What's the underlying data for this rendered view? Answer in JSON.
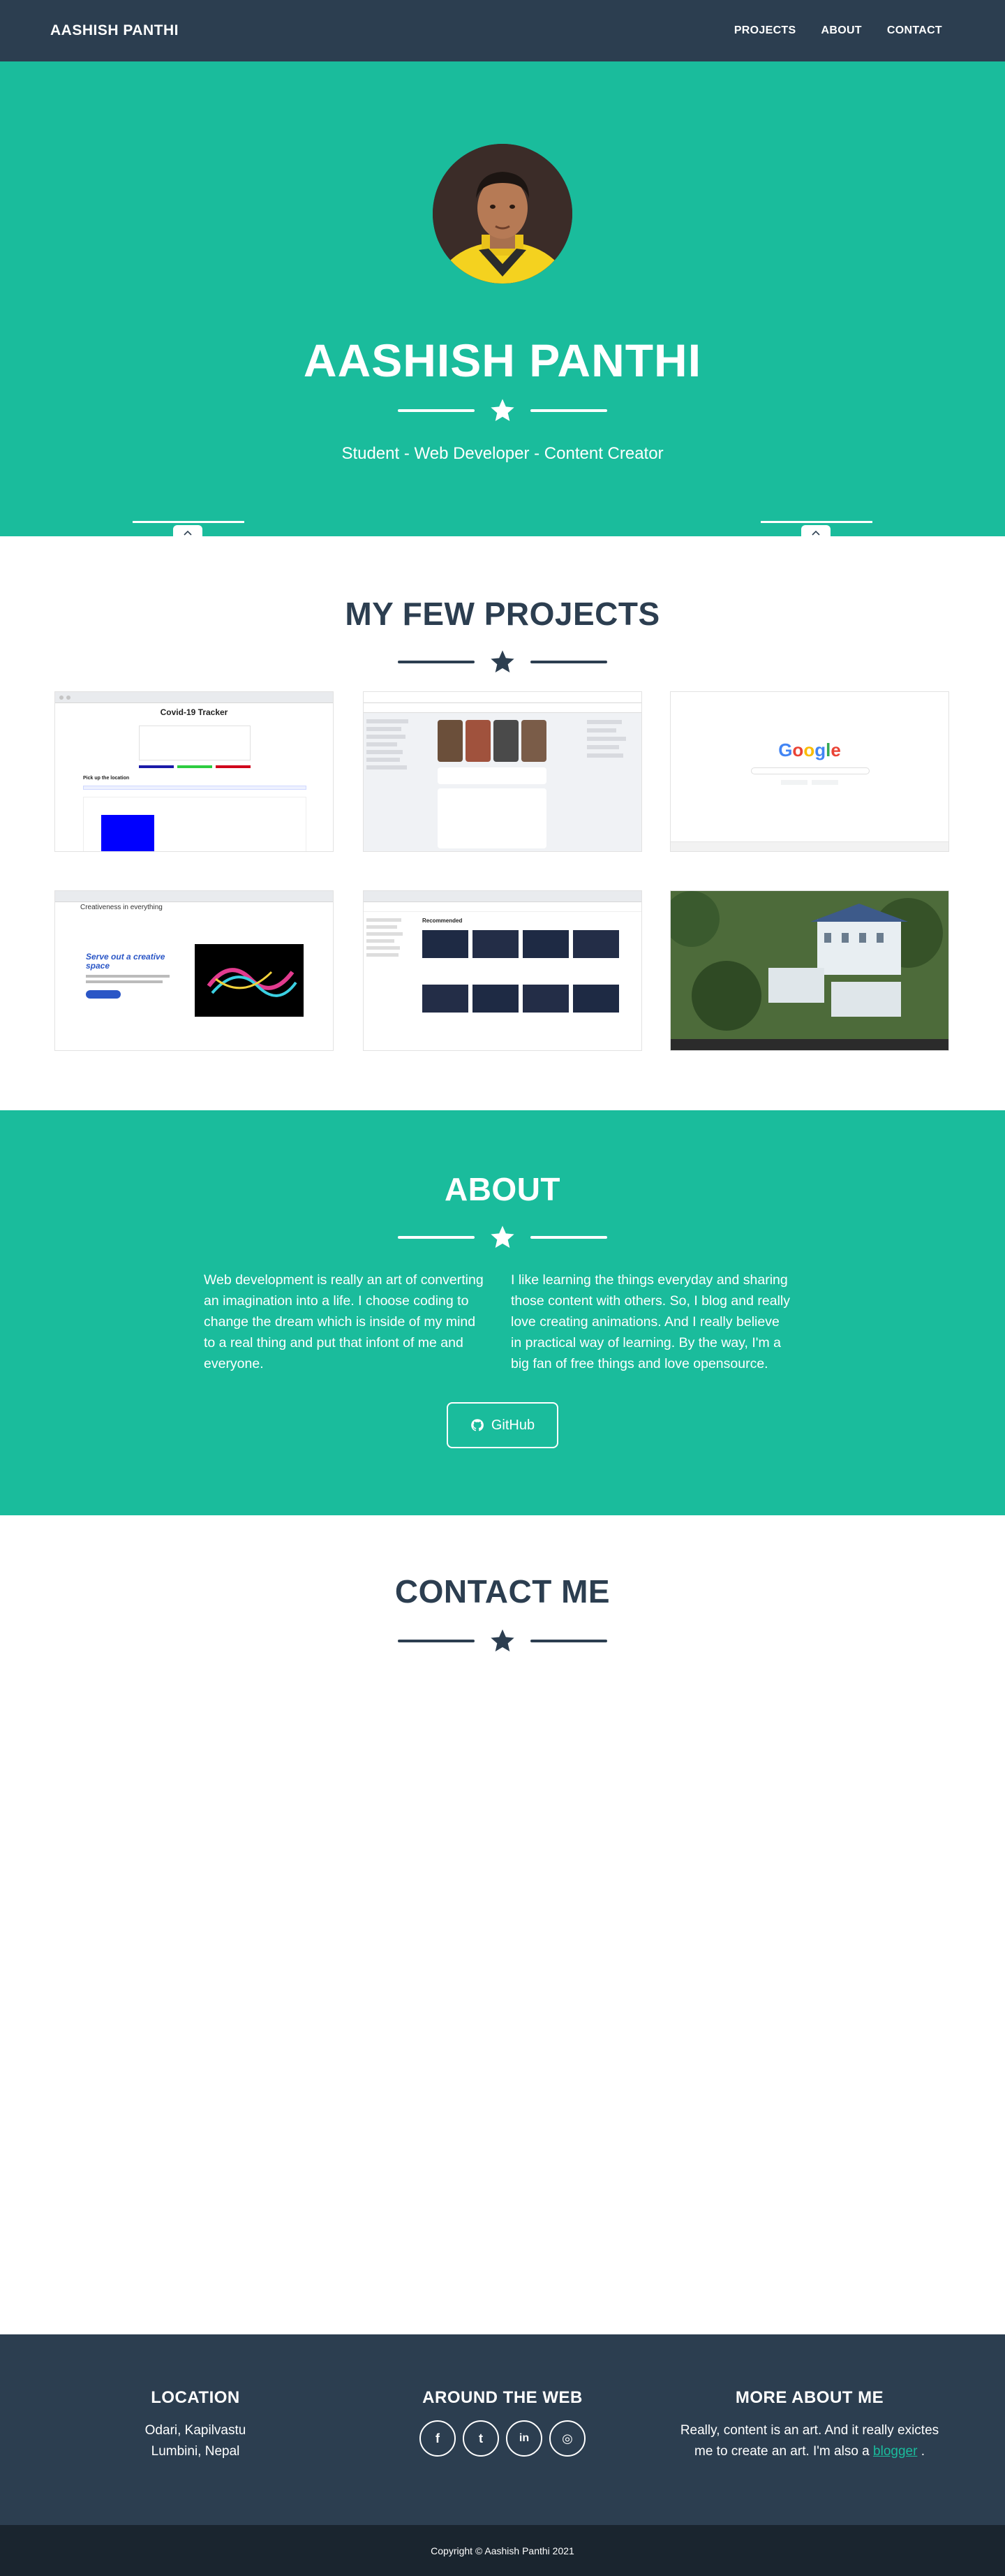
{
  "nav": {
    "brand": "AASHISH PANTHI",
    "links": [
      "PROJECTS",
      "ABOUT",
      "CONTACT"
    ]
  },
  "hero": {
    "title": "AASHISH PANTHI",
    "subtitle": "Student - Web Developer - Content Creator"
  },
  "projects": {
    "title": "MY FEW PROJECTS",
    "items": [
      {
        "heading": "Covid-19 Tracker",
        "text": "Pick up the location"
      },
      {
        "heading": "",
        "text": ""
      },
      {
        "heading": "Google",
        "text": ""
      },
      {
        "heading": "Creativeness in everything",
        "text": "Serve out a creative space"
      },
      {
        "heading": "Recommended",
        "text": ""
      },
      {
        "heading": "",
        "text": ""
      }
    ]
  },
  "about": {
    "title": "ABOUT",
    "left": "Web development is really an art of converting an imagination into a life. I choose coding to change the dream which is inside of my mind to a real thing and put that infont of me and everyone.",
    "right": "I like learning the things everyday and sharing those content with others. So, I blog and really love creating animations. And I really believe in practical way of learning. By the way, I'm a big fan of free things and love opensource.",
    "button": "GitHub"
  },
  "contact": {
    "title": "CONTACT ME"
  },
  "footer": {
    "location_title": "LOCATION",
    "location_line1": "Odari, Kapilvastu",
    "location_line2": "Lumbini, Nepal",
    "web_title": "AROUND THE WEB",
    "social": [
      {
        "icon": "facebook-icon",
        "glyph": "f"
      },
      {
        "icon": "twitter-icon",
        "glyph": "t"
      },
      {
        "icon": "linkedin-icon",
        "glyph": "in"
      },
      {
        "icon": "instagram-icon",
        "glyph": "◎"
      }
    ],
    "more_title": "MORE ABOUT ME",
    "more_text": "Really, content is an art. And it really exictes me to create an art. I'm also a",
    "more_link": "blogger",
    "more_end": ".",
    "copyright": "Copyright © Aashish Panthi 2021"
  },
  "colors": {
    "primary": "#2c3e50",
    "accent": "#1abc9c",
    "footer_bottom": "#1a252f"
  }
}
